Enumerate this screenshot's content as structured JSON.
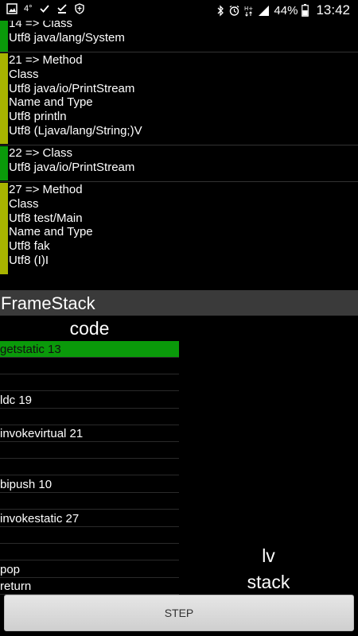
{
  "status_bar": {
    "temperature": "4°",
    "battery_percent": "44%",
    "time": "13:42",
    "left_icons": [
      "gallery-icon",
      "check-icon",
      "download-check-icon",
      "shield-icon"
    ],
    "right_icons": [
      "bluetooth-icon",
      "alarm-icon",
      "hplus-data-icon",
      "signal-icon",
      "battery-icon"
    ]
  },
  "constant_pool": {
    "entries": [
      {
        "lines": [
          "14 => Class",
          "Utf8 java/lang/System"
        ],
        "bar_color": "#0a9a0a"
      },
      {
        "lines": [
          "21 => Method",
          "Class",
          "Utf8 java/io/PrintStream",
          "Name and Type",
          "Utf8 println",
          "Utf8 (Ljava/lang/String;)V"
        ],
        "bar_color": "#a8b400"
      },
      {
        "lines": [
          "22 => Class",
          "Utf8 java/io/PrintStream"
        ],
        "bar_color": "#0a9a0a"
      },
      {
        "lines": [
          "27 => Method",
          "Class",
          "Utf8 test/Main",
          "Name and Type",
          "Utf8 fak",
          "Utf8 (I)I"
        ],
        "bar_color": "#a8b400"
      }
    ]
  },
  "frame_stack": {
    "title": "FrameStack",
    "code_heading": "code",
    "lv_label": "lv",
    "stack_label": "stack",
    "active_color": "#0a9a0a",
    "code_rows": [
      {
        "text": "getstatic 13",
        "active": true
      },
      {
        "text": "",
        "active": false
      },
      {
        "text": "",
        "active": false
      },
      {
        "text": "ldc 19",
        "active": false
      },
      {
        "text": "",
        "active": false
      },
      {
        "text": "invokevirtual 21",
        "active": false
      },
      {
        "text": "",
        "active": false
      },
      {
        "text": "",
        "active": false
      },
      {
        "text": "bipush 10",
        "active": false
      },
      {
        "text": "",
        "active": false
      },
      {
        "text": "invokestatic 27",
        "active": false
      },
      {
        "text": "",
        "active": false
      },
      {
        "text": "",
        "active": false
      },
      {
        "text": "pop",
        "active": false
      },
      {
        "text": "return",
        "active": false
      }
    ]
  },
  "step_button": {
    "label": "STEP"
  }
}
